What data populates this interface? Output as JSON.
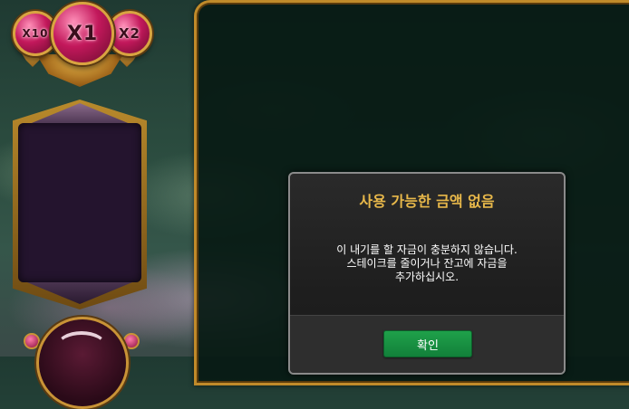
{
  "multipliers": {
    "left": "X10",
    "center": "X1",
    "right": "X2"
  },
  "modal": {
    "title": "사용 가능한 금액 없음",
    "message_lines": [
      "이 내기를 할 자금이 충분하지 않습니다.",
      "스테이크를 줄이거나 잔고에 자금을",
      "추가하십시오."
    ],
    "ok_label": "확인"
  },
  "colors": {
    "title_gold": "#e8b84a",
    "ok_green": "#1fa14a",
    "frame_gold": "#c08a2a"
  }
}
